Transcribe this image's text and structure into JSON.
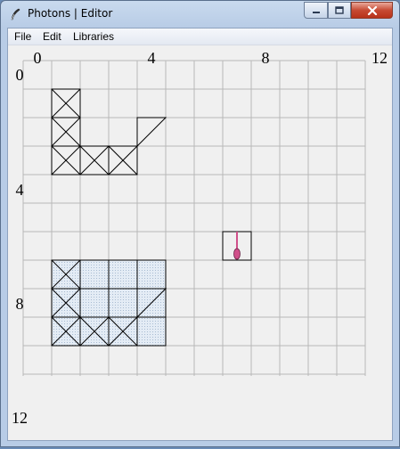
{
  "window": {
    "title": "Photons | Editor",
    "icon": "feather-icon",
    "controls": [
      "minimize-icon",
      "maximize-icon",
      "close-icon"
    ]
  },
  "menu": {
    "file": "File",
    "edit": "Edit",
    "libraries": "Libraries"
  },
  "editor": {
    "grid": {
      "cols": 12,
      "rows": 11
    },
    "top_axis_labels": [
      "0",
      "4",
      "8",
      "12"
    ],
    "left_axis_labels": [
      "0",
      "4",
      "8",
      "12"
    ],
    "blocks": [
      {
        "c": 1,
        "r": 1,
        "type": "cross"
      },
      {
        "c": 1,
        "r": 2,
        "type": "cross"
      },
      {
        "c": 1,
        "r": 3,
        "type": "cross"
      },
      {
        "c": 2,
        "r": 3,
        "type": "cross"
      },
      {
        "c": 3,
        "r": 3,
        "type": "cross"
      },
      {
        "c": 4,
        "r": 2,
        "type": "mirror"
      },
      {
        "c": 1,
        "r": 7,
        "type": "cross"
      },
      {
        "c": 1,
        "r": 8,
        "type": "cross"
      },
      {
        "c": 1,
        "r": 9,
        "type": "cross"
      },
      {
        "c": 2,
        "r": 9,
        "type": "cross"
      },
      {
        "c": 3,
        "r": 9,
        "type": "cross"
      },
      {
        "c": 4,
        "r": 8,
        "type": "mirror"
      },
      {
        "c": 4,
        "r": 9,
        "type": "plain"
      },
      {
        "c": 2,
        "r": 7,
        "type": "plain"
      },
      {
        "c": 3,
        "r": 7,
        "type": "plain"
      },
      {
        "c": 4,
        "r": 7,
        "type": "plain"
      },
      {
        "c": 2,
        "r": 8,
        "type": "plain"
      },
      {
        "c": 3,
        "r": 8,
        "type": "plain"
      }
    ],
    "shaded_region": {
      "c": 1,
      "r": 7,
      "w": 4,
      "h": 3
    },
    "emitter": {
      "c": 7,
      "r": 6
    },
    "colors": {
      "grid": "#b8b8b8",
      "block_line": "#000000",
      "shade": "#dfe8f2",
      "emitter": "#d0508a"
    }
  }
}
